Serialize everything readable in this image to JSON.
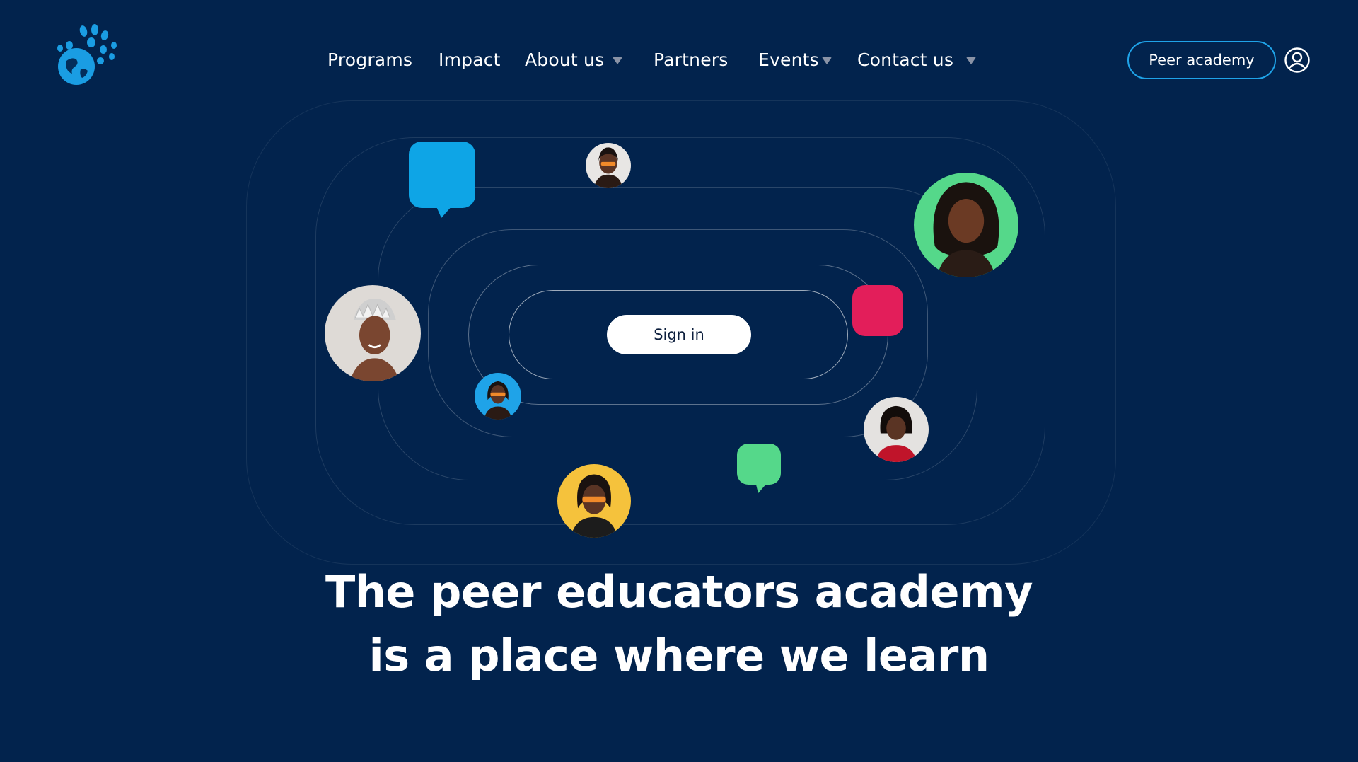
{
  "nav": {
    "programs": "Programs",
    "impact": "Impact",
    "about": "About us",
    "partners": "Partners",
    "events": "Events",
    "contact": "Contact us"
  },
  "header": {
    "peer_academy_label": "Peer academy",
    "user_icon": "user-circle-icon",
    "logo_icon": "hand-globe-logo-icon"
  },
  "hero": {
    "signin_label": "Sign in",
    "headline_line1": "The peer educators academy",
    "headline_line2": "is a place where we learn"
  },
  "colors": {
    "background": "#02234d",
    "accent_blue": "#1fa3e8",
    "accent_green": "#55d88a",
    "accent_pink": "#e31e5a",
    "accent_yellow": "#f5c23c"
  }
}
